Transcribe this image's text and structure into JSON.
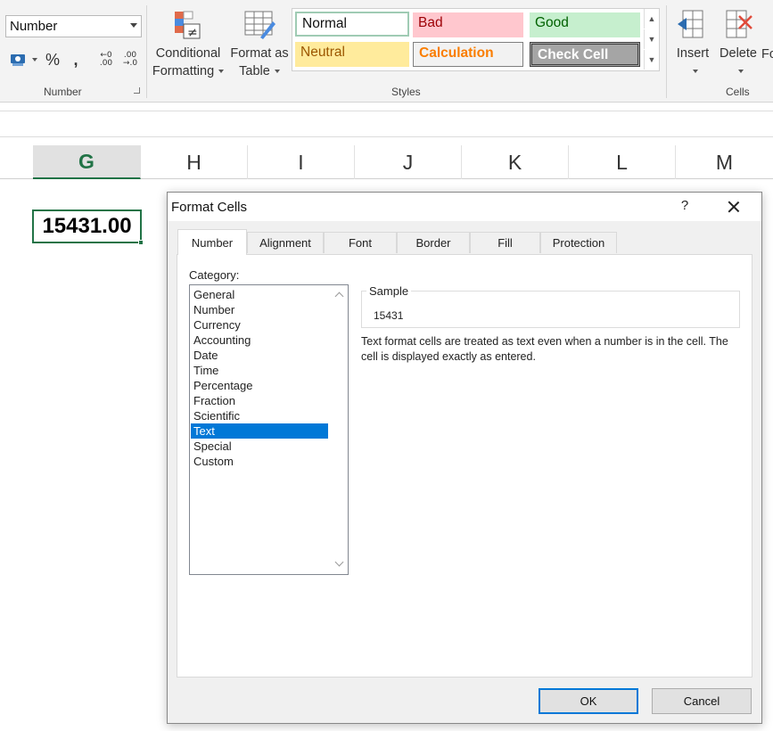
{
  "ribbon": {
    "number_format_value": "Number",
    "number_group_label": "Number",
    "percent_symbol": "%",
    "comma_symbol": ",",
    "increase_decimal": {
      "top": "←0",
      "bottom": ".00"
    },
    "decrease_decimal": {
      "top": ".00",
      "bottom": "→.0"
    },
    "conditional_formatting": {
      "line1": "Conditional",
      "line2": "Formatting"
    },
    "format_as_table": {
      "line1": "Format as",
      "line2": "Table"
    },
    "styles_group_label": "Styles",
    "styles": {
      "normal": "Normal",
      "bad": "Bad",
      "good": "Good",
      "neutral": "Neutral",
      "calculation": "Calculation",
      "check_cell": "Check Cell"
    },
    "insert_label": "Insert",
    "delete_label": "Delete",
    "format_label_partial": "Fo",
    "cells_group_label": "Cells"
  },
  "sheet": {
    "columns": [
      "G",
      "H",
      "I",
      "J",
      "K",
      "L",
      "M"
    ],
    "selected_column": "G",
    "active_cell_value": "15431.00"
  },
  "dialog": {
    "title": "Format Cells",
    "help": "?",
    "tabs": [
      "Number",
      "Alignment",
      "Font",
      "Border",
      "Fill",
      "Protection"
    ],
    "active_tab": "Number",
    "category_label": "Category:",
    "categories": [
      "General",
      "Number",
      "Currency",
      "Accounting",
      "Date",
      "Time",
      "Percentage",
      "Fraction",
      "Scientific",
      "Text",
      "Special",
      "Custom"
    ],
    "selected_category": "Text",
    "sample_label": "Sample",
    "sample_value": "15431",
    "description": "Text format cells are treated as text even when a number is in the cell. The cell is displayed exactly as entered.",
    "ok_label": "OK",
    "cancel_label": "Cancel"
  },
  "colors": {
    "excel_green": "#217346",
    "selection_blue": "#0078d7"
  }
}
